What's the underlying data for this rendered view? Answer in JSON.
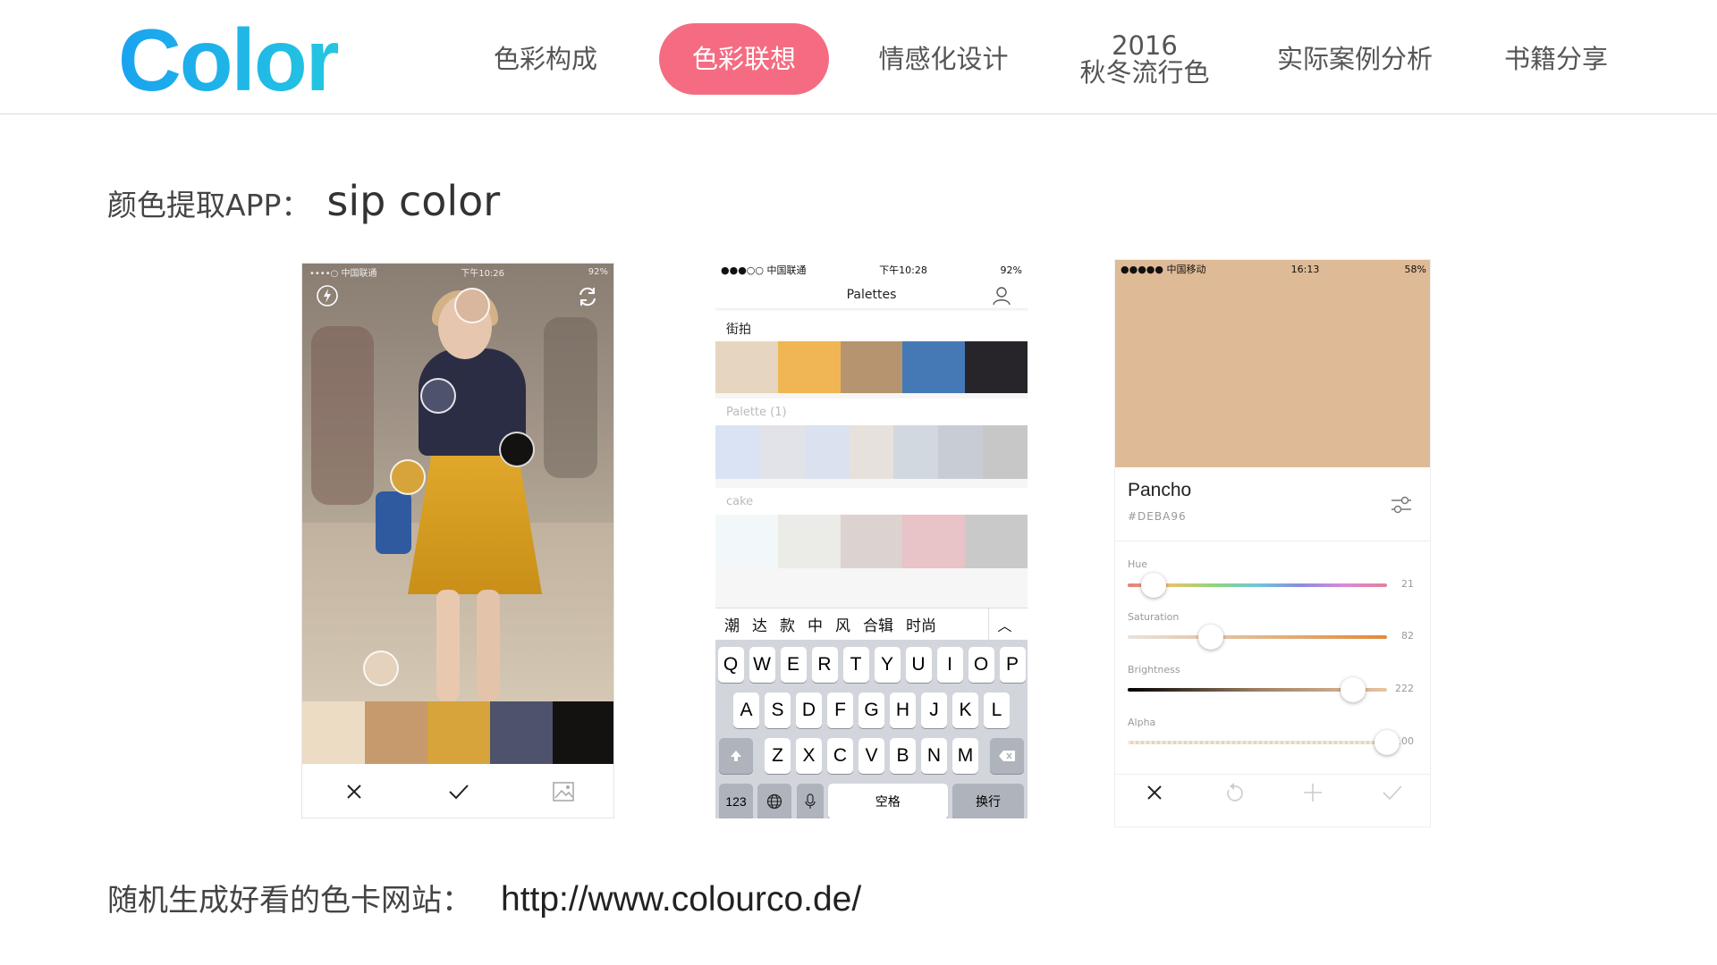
{
  "nav": {
    "logo": "Color",
    "items": [
      {
        "label": "色彩构成"
      },
      {
        "label": "色彩联想"
      },
      {
        "label": "情感化设计"
      },
      {
        "label": "2016\n秋冬流行色"
      },
      {
        "label": "实际案例分析"
      },
      {
        "label": "书籍分享"
      }
    ],
    "active_index": 1,
    "active_color": "#f56c82"
  },
  "heading": {
    "prefix": "颜色提取APP：",
    "app_name": "sip color"
  },
  "footer": {
    "prefix": "随机生成好看的色卡网站：",
    "url": "http://www.colourco.de/"
  },
  "phone1": {
    "status_left": "••••○ 中国联通",
    "status_time": "下午10:26",
    "status_right": "92%",
    "swatches": [
      "#ecdcc4",
      "#c69a6c",
      "#d7a33b",
      "#4e526c",
      "#141111"
    ],
    "icons": [
      "flash-icon",
      "switch-camera-icon",
      "close-icon",
      "check-icon",
      "gallery-icon"
    ]
  },
  "phone2": {
    "status_left": "●●●○○ 中国联通",
    "status_time": "下午10:28",
    "status_right": "92%",
    "title": "Palettes",
    "palettes": [
      {
        "name": "街拍",
        "colors": [
          "#e7d6bf",
          "#f0b653",
          "#b69470",
          "#4479b5",
          "#27252a"
        ]
      },
      {
        "name": "Palette (1)",
        "colors": [
          "#dae3f3",
          "#e1e3e8",
          "#d9e2ee",
          "#e6e1dc",
          "#d2d8e0",
          "#c8ccd5",
          "#c7c7c7"
        ]
      },
      {
        "name": "cake",
        "colors": [
          "#f2f8fa",
          "#ebebe8",
          "#dcd2cf",
          "#e8c3c8",
          "#c9c9c9"
        ]
      }
    ],
    "suggestions": [
      "潮",
      "达",
      "款",
      "中",
      "风",
      "合辑",
      "时尚"
    ],
    "keyboard": {
      "row1": [
        "Q",
        "W",
        "E",
        "R",
        "T",
        "Y",
        "U",
        "I",
        "O",
        "P"
      ],
      "row2": [
        "A",
        "S",
        "D",
        "F",
        "G",
        "H",
        "J",
        "K",
        "L"
      ],
      "row3": [
        "Z",
        "X",
        "C",
        "V",
        "B",
        "N",
        "M"
      ],
      "numbers_key": "123",
      "space_key": "空格",
      "return_key": "换行"
    }
  },
  "phone3": {
    "status_left": "●●●●● 中国移动",
    "status_time": "16:13",
    "status_right": "58%",
    "color_hex": "#deba96",
    "name": "Pancho",
    "hex_label": "#DEBA96",
    "sliders": [
      {
        "label": "Hue",
        "value": "21",
        "position": 0.1
      },
      {
        "label": "Saturation",
        "value": "82",
        "position": 0.32
      },
      {
        "label": "Brightness",
        "value": "222",
        "position": 0.87
      },
      {
        "label": "Alpha",
        "value": "100",
        "position": 1.0
      }
    ]
  }
}
